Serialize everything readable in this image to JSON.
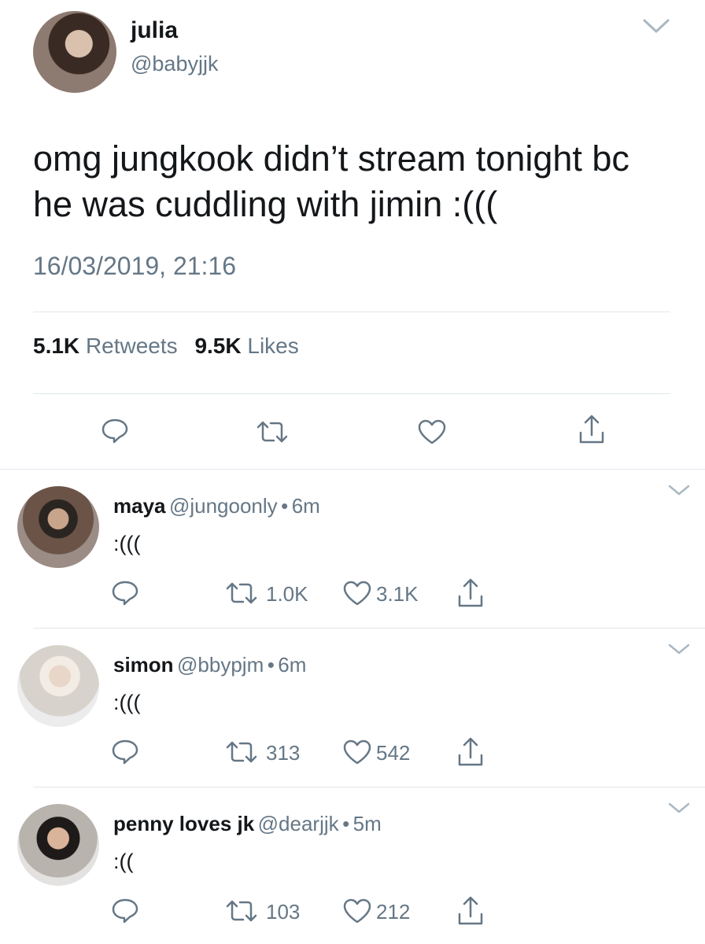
{
  "main_tweet": {
    "display_name": "julia",
    "handle": "@babyjjk",
    "text_line1": "omg jungkook didn’t stream tonight bc",
    "text_line2": "he was cuddling with jimin :(((",
    "timestamp": "16/03/2019, 21:16",
    "retweets_count": "5.1K",
    "retweets_label": "Retweets",
    "likes_count": "9.5K",
    "likes_label": "Likes",
    "actions": [
      "reply-icon",
      "retweet-icon",
      "heart-icon",
      "share-icon"
    ]
  },
  "replies": [
    {
      "display_name": "maya",
      "handle": "@jungoonly",
      "separator": "•",
      "time": "6m",
      "text": ":(((",
      "retweets": "1.0K",
      "likes": "3.1K"
    },
    {
      "display_name": "simon",
      "handle": "@bbypjm",
      "separator": "•",
      "time": "6m",
      "text": ":(((",
      "retweets": "313",
      "likes": "542"
    },
    {
      "display_name": "penny loves jk",
      "handle": "@dearjjk",
      "separator": "•",
      "time": "5m",
      "text": ":((",
      "retweets": "103",
      "likes": "212"
    }
  ],
  "colors": {
    "text": "#14171a",
    "muted": "#657786",
    "divider": "#e1e8ed",
    "chevron": "#aab8c2"
  }
}
